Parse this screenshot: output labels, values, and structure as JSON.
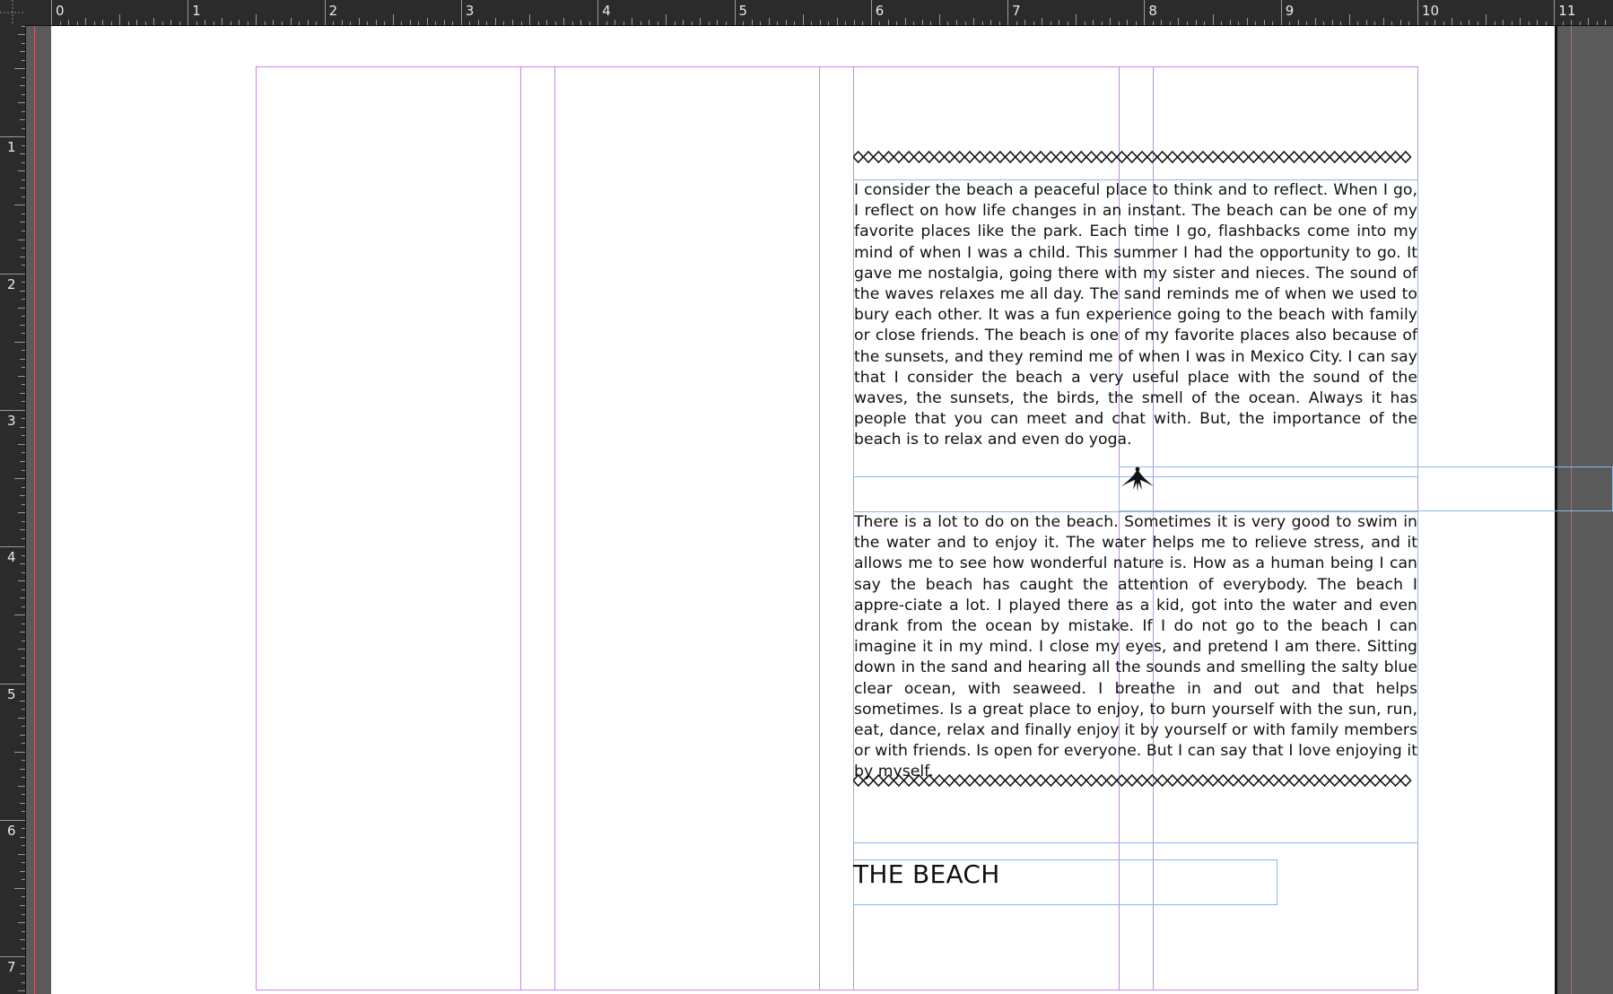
{
  "ruler": {
    "horizontal": [
      "0",
      "1",
      "2",
      "3",
      "4",
      "5",
      "6",
      "7",
      "8",
      "9",
      "10",
      "11"
    ],
    "vertical": [
      "1",
      "2",
      "3",
      "4",
      "5",
      "6",
      "7"
    ]
  },
  "document": {
    "divider_icon": "diamond-chain-divider",
    "ornament_icon": "palm-ornament",
    "paragraph_1": "I consider the beach a peaceful place to think and to reflect. When I go, I reflect on how life changes in an instant. The beach can be one of my favorite places like the park. Each time I go, flashbacks come into my mind of when I was a child. This summer I had the opportunity to go. It gave me nostalgia, going there with my sister and nieces. The sound of the waves relaxes me all day. The sand reminds me of when we used to bury each other. It was a fun experience going to the beach with family or close friends. The beach is one of my favorite places also because of the sunsets, and they  remind me of when I was in Mexico City. I can say that I consider the beach a very useful place with the sound of the waves, the sunsets, the birds, the smell of the ocean. Always it has people that you can meet and chat with. But, the importance of the beach is to relax and even do yoga.",
    "paragraph_2": "There is a lot to do on the beach. Sometimes it is very good to swim in the water and to enjoy it. The water helps me to relieve stress, and it allows me to see how wonderful nature is. How as a human being I can say the beach has caught the attention of everybody. The beach I appre-ciate a lot. I played there as a kid, got into the water and even drank from the ocean by mistake. If I do not go to the beach I can imagine it in my mind. I close my eyes, and pretend I am there. Sitting down in the sand and hearing all the sounds and smelling the salty blue clear ocean, with seaweed. I breathe in and out and that helps sometimes. Is a great place to enjoy, to burn yourself with the sun, run, eat, dance, relax and finally enjoy it by yourself or with family members or with friends. Is open for everyone. But I can say that I love enjoying it by myself.",
    "heading": "THE BEACH"
  },
  "colors": {
    "margin_guide": "#c58be6",
    "frame_edge": "#8fb5e8",
    "bleed": "#e6556b"
  }
}
